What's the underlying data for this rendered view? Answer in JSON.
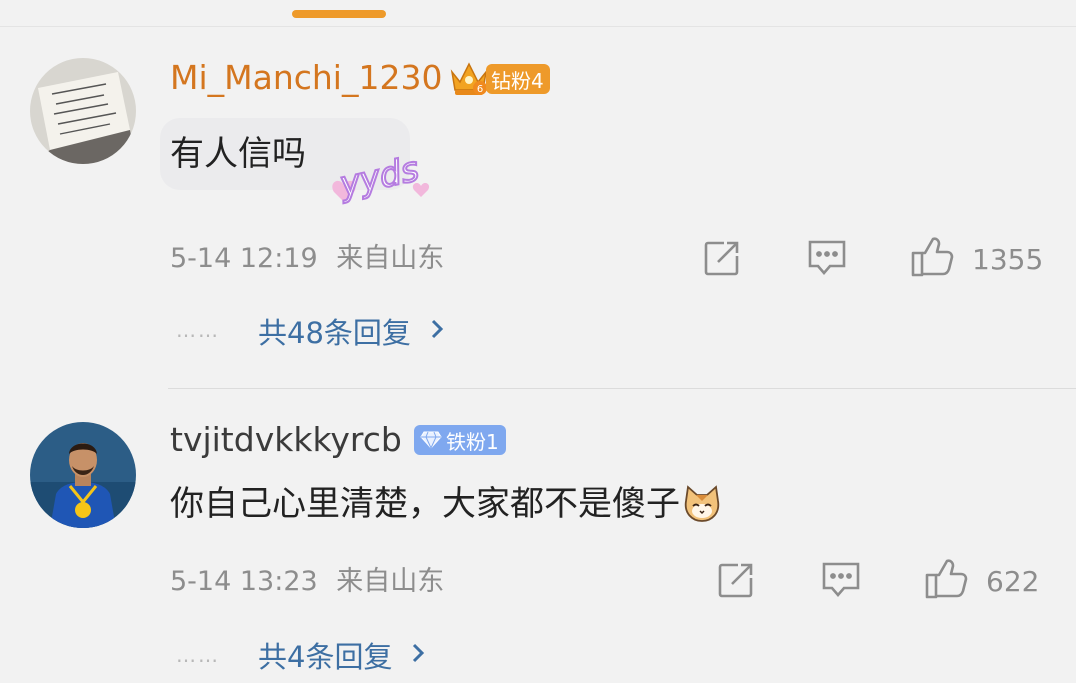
{
  "accent_color": "#ee9a2a",
  "link_color": "#3d6fa3",
  "comments": [
    {
      "username": "Mi_Manchi_1230",
      "username_color": "#d4761f",
      "badge_label": "钻粉4",
      "badge_icon": "crown-icon",
      "text": "有人信吗",
      "sticker_text": "yyds",
      "time": "5-14 12:19",
      "location": "来自山东",
      "like_count": "1355",
      "replies_label": "共48条回复",
      "dots": "……"
    },
    {
      "username": "tvjitdvkkkyrcb",
      "username_color": "#3b3b3b",
      "badge_label": "铁粉1",
      "badge_icon": "diamond-icon",
      "text": "你自己心里清楚，大家都不是傻子",
      "emoji": "cat-emoji",
      "time": "5-14 13:23",
      "location": "来自山东",
      "like_count": "622",
      "replies_label": "共4条回复",
      "dots": "……"
    }
  ]
}
